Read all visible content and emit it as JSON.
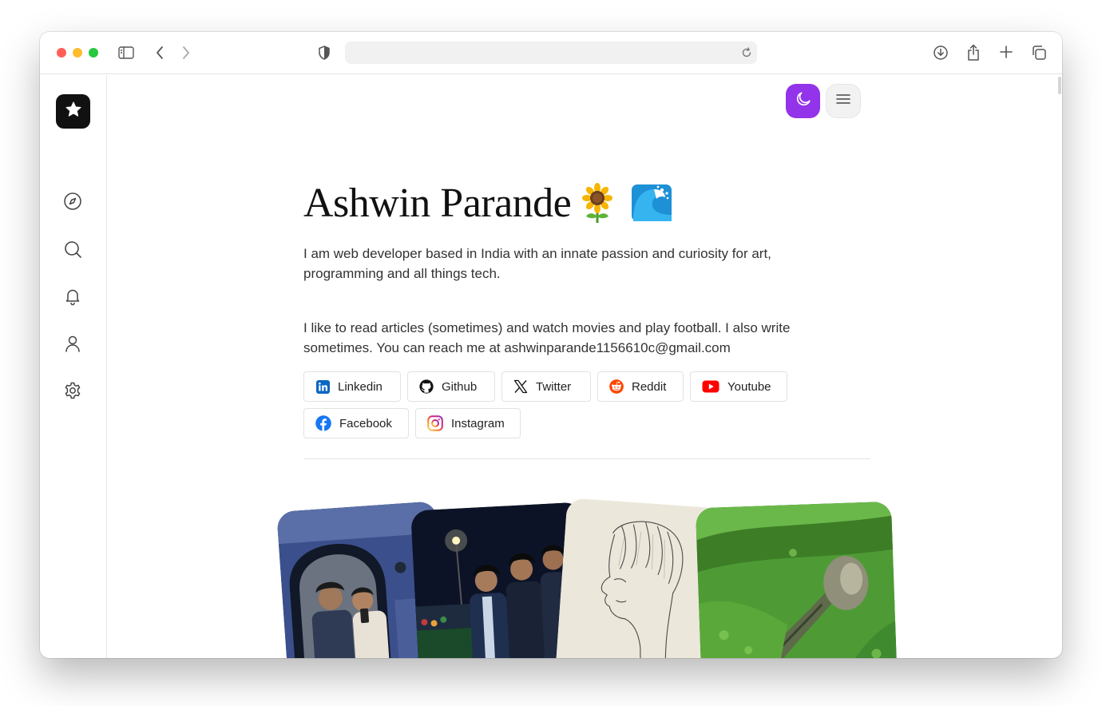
{
  "profile": {
    "name": "Ashwin Parande",
    "name_emojis": [
      "sunflower-emoji",
      "wave-emoji"
    ],
    "bio_paragraph_1": "I am web developer based in India with an innate passion and curiosity for art, programming and all things tech.",
    "bio_paragraph_2": "I like to read articles (sometimes) and watch movies and play football. I also write sometimes. You can reach me at ashwinparande1156610c@gmail.com"
  },
  "socials": [
    {
      "label": "Linkedin",
      "icon": "linkedin-icon",
      "color": "#0a66c2"
    },
    {
      "label": "Github",
      "icon": "github-icon",
      "color": "#111111"
    },
    {
      "label": "Twitter",
      "icon": "x-icon",
      "color": "#111111"
    },
    {
      "label": "Reddit",
      "icon": "reddit-icon",
      "color": "#ff4500"
    },
    {
      "label": "Youtube",
      "icon": "youtube-icon",
      "color": "#ff0000"
    },
    {
      "label": "Facebook",
      "icon": "facebook-icon",
      "color": "#1877f2"
    },
    {
      "label": "Instagram",
      "icon": "instagram-icon",
      "color": "#e1306c"
    }
  ],
  "sidebar": {
    "logo_icon": "star-icon",
    "items": [
      "compass-icon",
      "search-icon",
      "bell-icon",
      "user-icon",
      "gear-icon"
    ]
  },
  "header": {
    "theme_toggle_icon": "moon-icon",
    "menu_icon": "hamburger-icon"
  },
  "browser": {
    "url": "",
    "toolbar_icons": [
      "sidebar-toggle-icon",
      "back-icon",
      "forward-icon",
      "shield-icon",
      "reload-icon",
      "download-icon",
      "share-icon",
      "new-tab-icon",
      "tabs-overview-icon"
    ]
  },
  "gallery": {
    "photos": [
      "photo-friends-mirror",
      "photo-group-night",
      "photo-pencil-sketch",
      "photo-green-landscape"
    ]
  },
  "colors": {
    "accent": "#9333ea",
    "logo_bg": "#111111"
  }
}
